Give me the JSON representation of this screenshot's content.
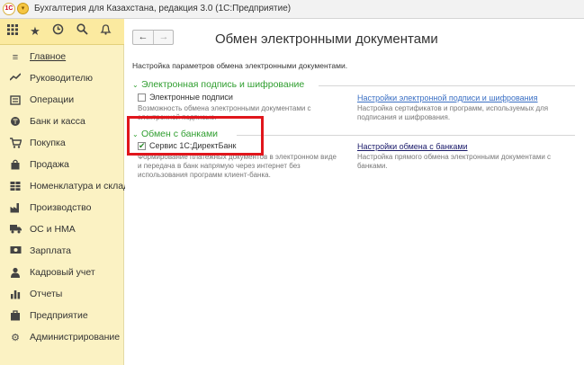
{
  "titlebar": {
    "logo_text": "1С",
    "title": "Бухгалтерия для Казахстана, редакция 3.0  (1С:Предприятие)"
  },
  "toolbar": {
    "icons": [
      "apps-grid-icon",
      "favorites-star-icon",
      "history-icon",
      "search-icon",
      "notifications-bell-icon"
    ]
  },
  "sidebar": {
    "items": [
      {
        "label": "Главное",
        "icon": "menu-lines-icon",
        "active": true
      },
      {
        "label": "Руководителю",
        "icon": "trend-icon"
      },
      {
        "label": "Операции",
        "icon": "operations-icon"
      },
      {
        "label": "Банк и касса",
        "icon": "bank-icon"
      },
      {
        "label": "Покупка",
        "icon": "cart-icon"
      },
      {
        "label": "Продажа",
        "icon": "bag-icon"
      },
      {
        "label": "Номенклатура и склад",
        "icon": "warehouse-icon"
      },
      {
        "label": "Производство",
        "icon": "factory-icon"
      },
      {
        "label": "ОС и НМА",
        "icon": "truck-icon"
      },
      {
        "label": "Зарплата",
        "icon": "salary-icon"
      },
      {
        "label": "Кадровый учет",
        "icon": "person-icon"
      },
      {
        "label": "Отчеты",
        "icon": "reports-chart-icon"
      },
      {
        "label": "Предприятие",
        "icon": "enterprise-icon"
      },
      {
        "label": "Администрирование",
        "icon": "gear-icon"
      }
    ]
  },
  "main": {
    "nav": {
      "back": "←",
      "forward": "→"
    },
    "title": "Обмен электронными документами",
    "intro": "Настройка параметров обмена электронными документами.",
    "sections": [
      {
        "title": "Электронная подпись и шифрование",
        "checkbox_label": "Электронные подписи",
        "checked": false,
        "description": "Возможность обмена электронными документами с электронной подписью.",
        "link": "Настройки электронной подписи и шифрования",
        "link_description": "Настройка сертификатов и программ, используемых для подписания и шифрования."
      },
      {
        "title": "Обмен с банками",
        "checkbox_label": "Сервис 1С:ДиректБанк",
        "checked": true,
        "description": "Формирование платежных документов в электронном виде и передача в банк напрямую через интернет без использования программ клиент-банка.",
        "link": "Настройки обмена с банками",
        "link_description": "Настройка прямого обмена электронными документами с банками."
      }
    ]
  },
  "colors": {
    "sidebar_bg": "#fbf2c3",
    "toolbar_bg": "#fbeaa0",
    "section_green": "#2f9e2f",
    "link_blue": "#3a6fc4",
    "highlight_red": "#e0161c"
  }
}
